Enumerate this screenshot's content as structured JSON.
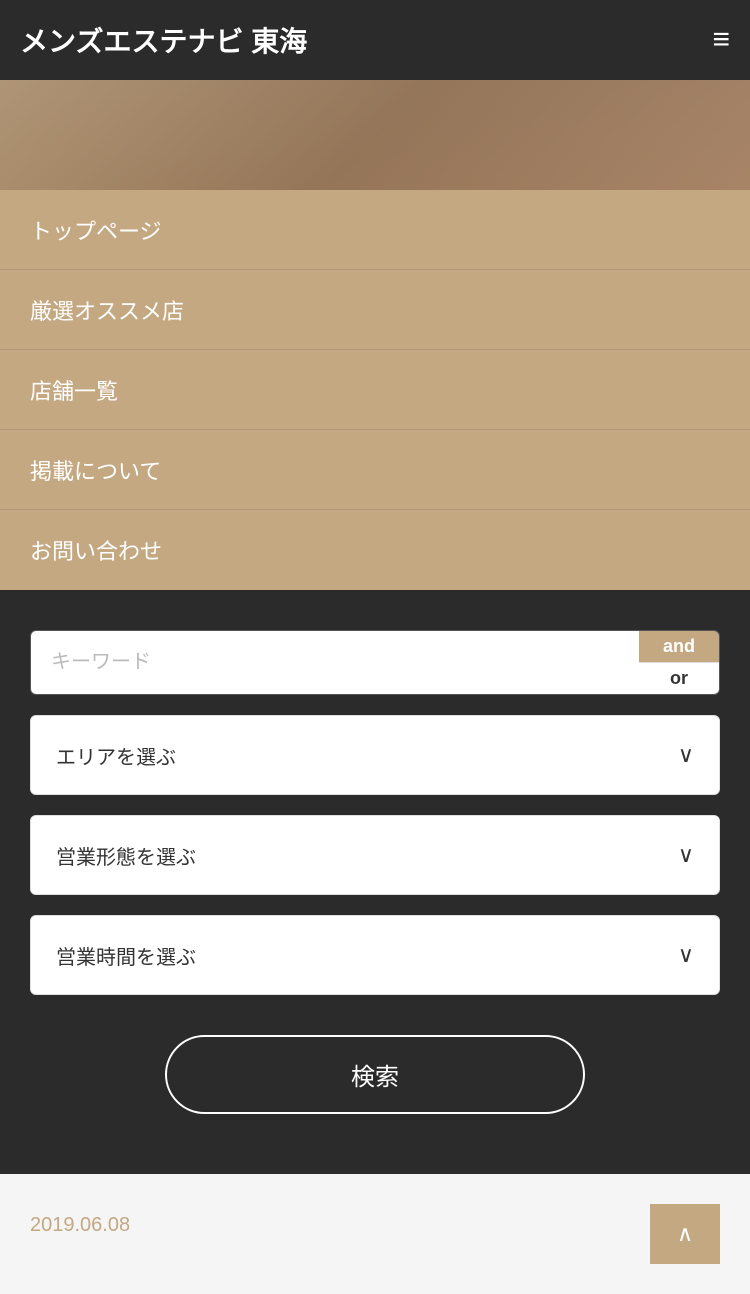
{
  "header": {
    "title": "メンズエステナビ 東海",
    "hamburger_icon": "≡"
  },
  "nav": {
    "items": [
      {
        "label": "トップページ"
      },
      {
        "label": "厳選オススメ店"
      },
      {
        "label": "店舗一覧"
      },
      {
        "label": "掲載について"
      },
      {
        "label": "お問い合わせ"
      }
    ]
  },
  "search": {
    "keyword_placeholder": "キーワード",
    "and_label": "and",
    "or_label": "or",
    "area_label": "エリアを選ぶ",
    "business_type_label": "営業形態を選ぶ",
    "business_hours_label": "営業時間を選ぶ",
    "search_button_label": "検索",
    "chevron": "∨"
  },
  "footer": {
    "date": "2019.06.08",
    "scroll_top_icon": "∧"
  }
}
